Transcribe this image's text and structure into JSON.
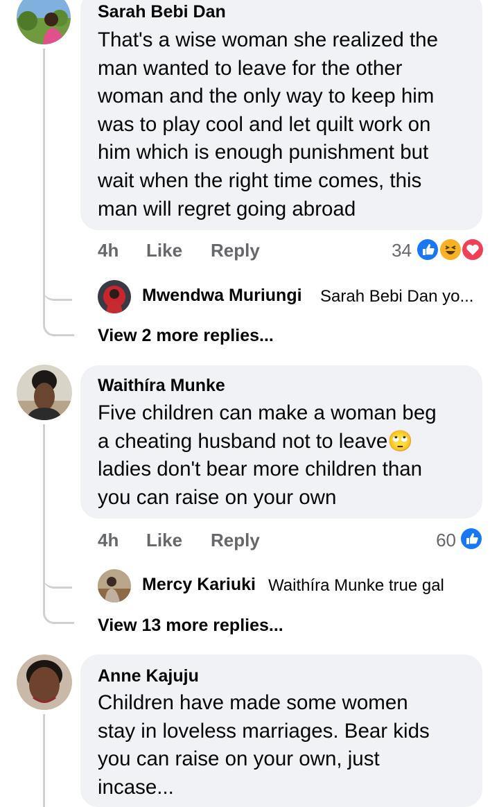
{
  "comments": [
    {
      "author": "Sarah Bebi Dan",
      "text": "That's a wise woman she realized the\nman wanted to leave for the other\nwoman and the only way to keep him\nwas to play cool and let quilt work on\nhim which is enough punishment but\nwait when the right time comes, this\nman will regret going abroad",
      "time": "4h",
      "like_label": "Like",
      "reply_label": "Reply",
      "reaction_count": "34",
      "reactions": [
        "like-icon",
        "haha-icon",
        "love-icon"
      ],
      "reply_preview": {
        "author": "Mwendwa Muriungi",
        "text": "Sarah Bebi Dan yo..."
      },
      "more_replies": "View 2 more replies..."
    },
    {
      "author": "Waithíra Munke",
      "text": "Five children can make a woman beg\na cheating husband not to leave🙄\nladies don't bear more children than\nyou can raise on your own",
      "time": "4h",
      "like_label": "Like",
      "reply_label": "Reply",
      "reaction_count": "60",
      "reactions": [
        "like-icon"
      ],
      "reply_preview": {
        "author": "Mercy Kariuki",
        "text": "Waithíra Munke  true gal"
      },
      "more_replies": "View 13 more replies..."
    },
    {
      "author": "Anne Kajuju",
      "text": "Children have made some women\nstay in loveless marriages. Bear kids\nyou can raise on your own, just\nincase..."
    }
  ],
  "colors": {
    "bubble": "#f0f2f5",
    "meta": "#65676b",
    "like": "#1877f2",
    "love": "#f33e58",
    "haha": "#f7b125"
  }
}
